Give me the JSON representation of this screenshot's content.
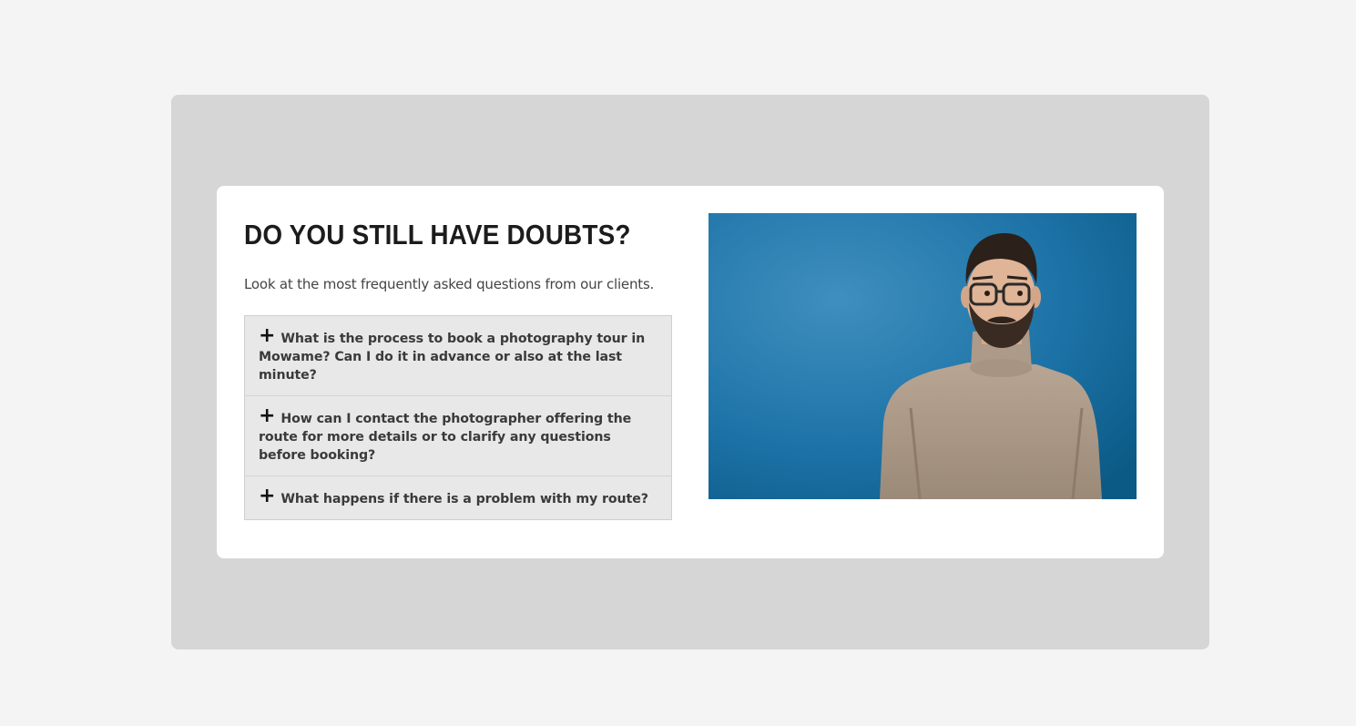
{
  "section": {
    "title": "DO YOU STILL HAVE DOUBTS?",
    "subtitle": "Look at the most frequently asked questions from our clients."
  },
  "faq": {
    "items": [
      {
        "question": "What is the process to book a photography tour in Mowame? Can I do it in advance or also at the last minute?"
      },
      {
        "question": "How can I contact the photographer offering the route for more details or to clarify any questions before booking?"
      },
      {
        "question": "What happens if there is a problem with my route?"
      }
    ]
  },
  "image": {
    "icon": "photo-man-glasses-blue-background"
  },
  "colors": {
    "page_bg": "#f4f4f4",
    "outer_bg": "#d6d6d6",
    "card_bg": "#ffffff",
    "faq_bg": "#e8e8e8",
    "photo_bg": "#1a6fa2"
  }
}
